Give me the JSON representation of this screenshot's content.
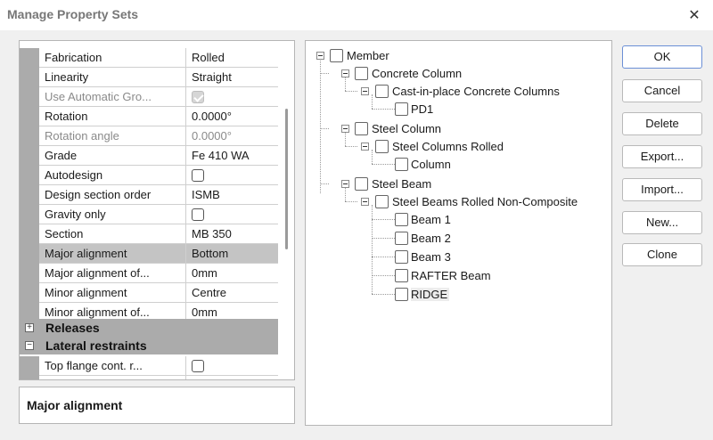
{
  "window": {
    "title": "Manage Property Sets",
    "close_glyph": "✕"
  },
  "properties": [
    {
      "name": "Fabrication",
      "value": "Rolled",
      "type": "text"
    },
    {
      "name": "Linearity",
      "value": "Straight",
      "type": "text"
    },
    {
      "name": "Use Automatic Gro...",
      "value": "",
      "type": "checkbox",
      "checked": true,
      "disabled": true
    },
    {
      "name": "Rotation",
      "value": "0.0000°",
      "type": "text"
    },
    {
      "name": "Rotation angle",
      "value": "0.0000°",
      "type": "text",
      "disabled": true
    },
    {
      "name": "Grade",
      "value": "Fe 410 WA",
      "type": "text"
    },
    {
      "name": "Autodesign",
      "value": "",
      "type": "checkbox",
      "checked": false
    },
    {
      "name": "Design section order",
      "value": "ISMB",
      "type": "text"
    },
    {
      "name": "Gravity only",
      "value": "",
      "type": "checkbox",
      "checked": false
    },
    {
      "name": "Section",
      "value": "MB 350",
      "type": "text"
    },
    {
      "name": "Major alignment",
      "value": "Bottom",
      "type": "text",
      "selected": true
    },
    {
      "name": "Major alignment of...",
      "value": "0mm",
      "type": "text"
    },
    {
      "name": "Minor alignment",
      "value": "Centre",
      "type": "text"
    },
    {
      "name": "Minor alignment of...",
      "value": "0mm",
      "type": "text"
    }
  ],
  "groups": [
    {
      "label": "Releases",
      "expander": "+"
    },
    {
      "label": "Lateral restraints",
      "expander": "−"
    }
  ],
  "lateral_properties": [
    {
      "name": "Top flange cont. r...",
      "value": "",
      "type": "checkbox",
      "checked": false
    }
  ],
  "description": {
    "text": "Major alignment"
  },
  "tree": {
    "member": "Member",
    "concrete_column": "Concrete Column",
    "cast_in_place": "Cast-in-place Concrete Columns",
    "pd1": "PD1",
    "steel_column": "Steel Column",
    "steel_columns_rolled": "Steel Columns Rolled",
    "column": "Column",
    "steel_beam": "Steel Beam",
    "steel_beams_rolled": "Steel Beams Rolled Non-Composite",
    "beam1": "Beam 1",
    "beam2": "Beam 2",
    "beam3": "Beam 3",
    "rafter": "RAFTER Beam",
    "ridge": "RIDGE"
  },
  "buttons": {
    "ok": "OK",
    "cancel": "Cancel",
    "delete": "Delete",
    "export": "Export...",
    "import": "Import...",
    "new": "New...",
    "clone": "Clone"
  }
}
